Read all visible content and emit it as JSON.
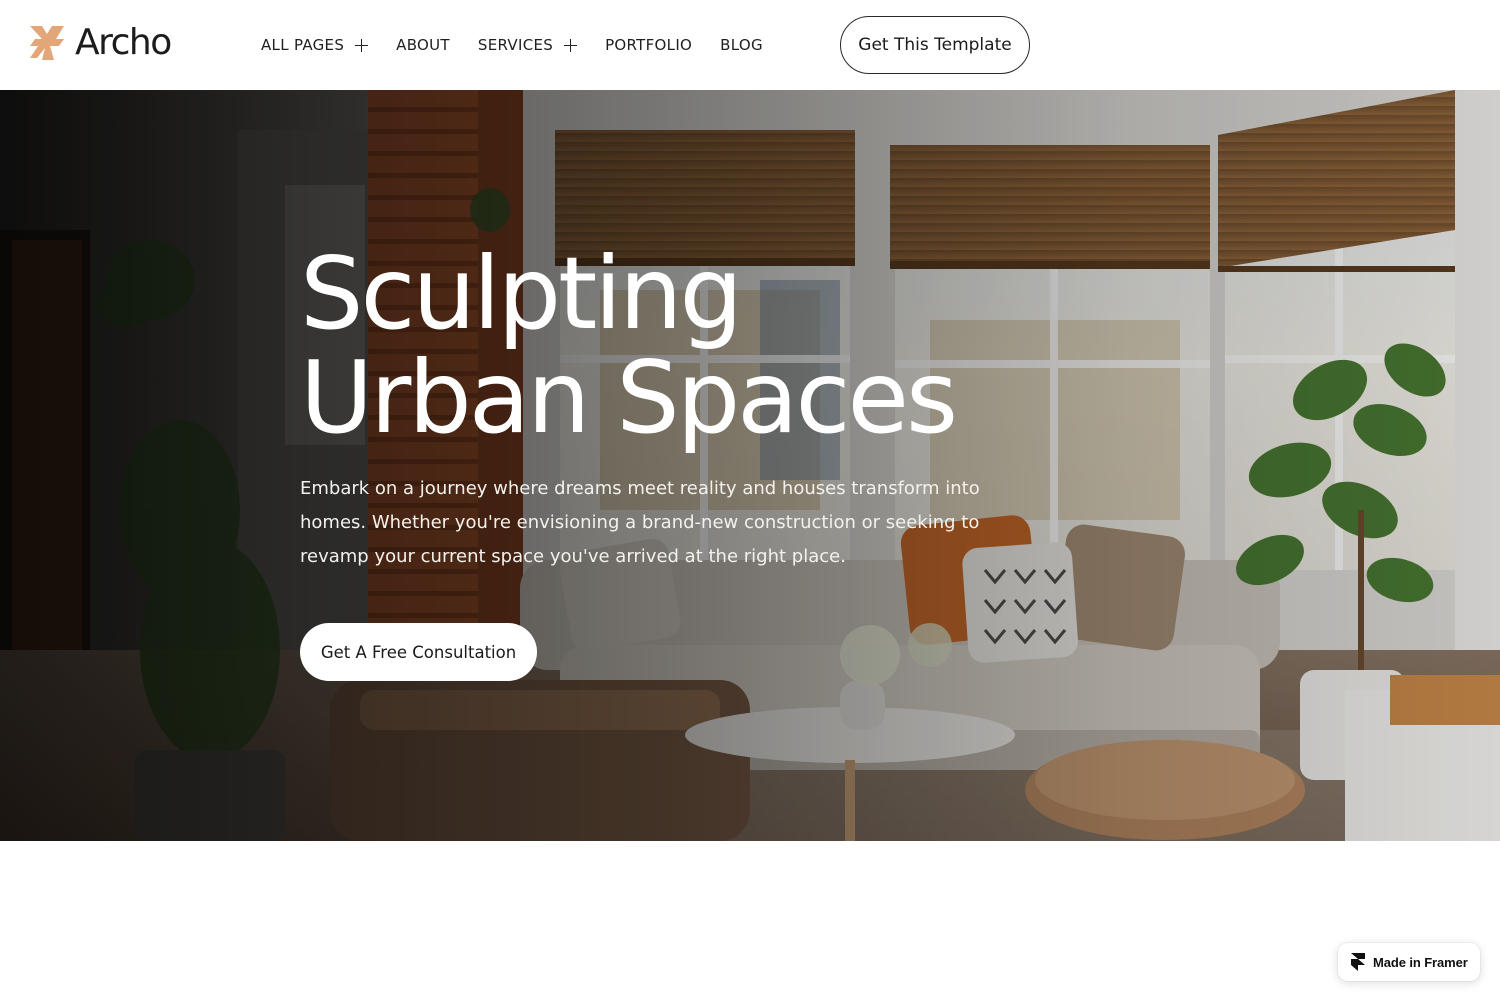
{
  "brand": {
    "name": "Archo",
    "logo_icon": "archo-star-mark-icon",
    "logo_color": "#E3A679"
  },
  "nav": {
    "items": [
      {
        "label": "ALL PAGES",
        "has_submenu": true,
        "icon": "plus-icon"
      },
      {
        "label": "ABOUT",
        "has_submenu": false
      },
      {
        "label": "SERVICES",
        "has_submenu": true,
        "icon": "plus-icon"
      },
      {
        "label": "PORTFOLIO",
        "has_submenu": false
      },
      {
        "label": "BLOG",
        "has_submenu": false
      }
    ]
  },
  "header_cta": {
    "label": "Get This Template"
  },
  "hero": {
    "title_line1": "Sculpting",
    "title_line2": "Urban Spaces",
    "description": "Embark on a journey where dreams meet reality and houses transform into homes. Whether you're envisioning a brand-new construction or seeking to revamp your current space you've arrived at the right place.",
    "cta_label": "Get A Free Consultation",
    "background_image": "living-room-interior-photo"
  },
  "badge": {
    "label": "Made in Framer",
    "icon": "framer-logo-icon"
  },
  "colors": {
    "accent": "#E3A679",
    "text_dark": "#1A1A1A",
    "hero_text": "#FFFFFF"
  }
}
